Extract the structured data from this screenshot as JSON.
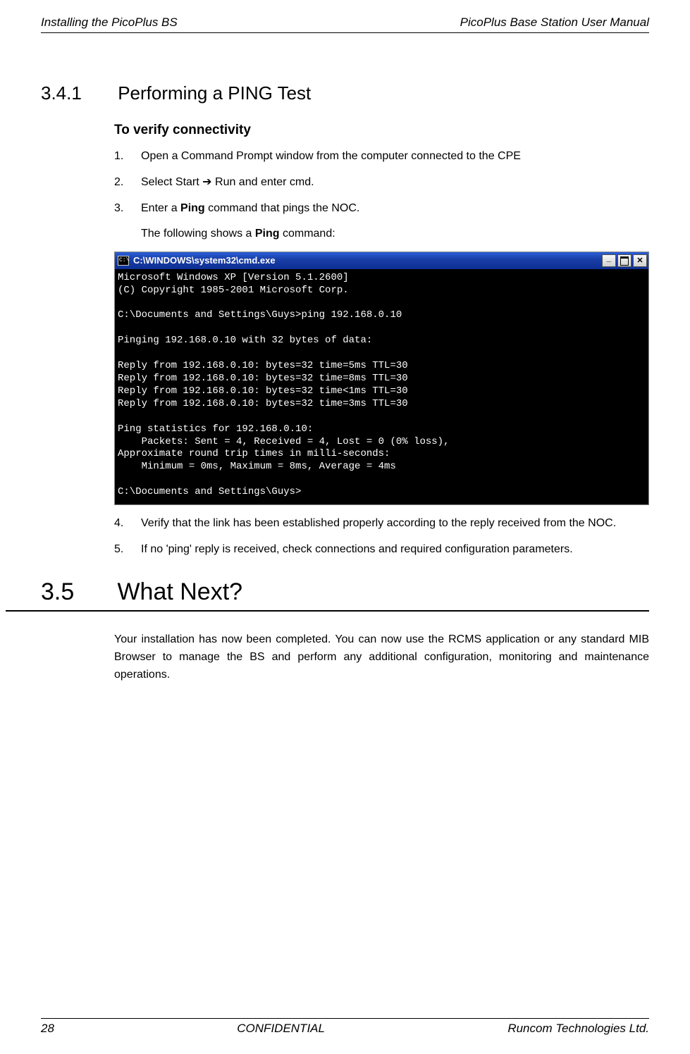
{
  "header": {
    "left": "Installing the PicoPlus BS",
    "right": "PicoPlus Base Station User Manual"
  },
  "section_341": {
    "number": "3.4.1",
    "title": "Performing a PING Test",
    "subhead": "To verify connectivity",
    "steps": [
      {
        "parts": [
          "Open a Command Prompt window from the computer connected to the CPE"
        ]
      },
      {
        "parts": [
          "Select Start ",
          {
            "arrow": "➔"
          },
          " Run and enter cmd."
        ]
      },
      {
        "parts": [
          "Enter a ",
          {
            "b": "Ping"
          },
          " command that pings the NOC."
        ],
        "followup_parts": [
          "The following shows a ",
          {
            "b": "Ping"
          },
          " command:"
        ]
      },
      {
        "parts": [
          "Verify that the link has been established properly according to the reply received from the NOC."
        ]
      },
      {
        "parts": [
          "If no 'ping' reply is received, check connections and required configuration parameters."
        ]
      }
    ]
  },
  "terminal": {
    "title": "C:\\WINDOWS\\system32\\cmd.exe",
    "lines": [
      "Microsoft Windows XP [Version 5.1.2600]",
      "(C) Copyright 1985-2001 Microsoft Corp.",
      "",
      "C:\\Documents and Settings\\Guys>ping 192.168.0.10",
      "",
      "Pinging 192.168.0.10 with 32 bytes of data:",
      "",
      "Reply from 192.168.0.10: bytes=32 time=5ms TTL=30",
      "Reply from 192.168.0.10: bytes=32 time=8ms TTL=30",
      "Reply from 192.168.0.10: bytes=32 time<1ms TTL=30",
      "Reply from 192.168.0.10: bytes=32 time=3ms TTL=30",
      "",
      "Ping statistics for 192.168.0.10:",
      "    Packets: Sent = 4, Received = 4, Lost = 0 (0% loss),",
      "Approximate round trip times in milli-seconds:",
      "    Minimum = 0ms, Maximum = 8ms, Average = 4ms",
      "",
      "C:\\Documents and Settings\\Guys>"
    ]
  },
  "section_35": {
    "number": "3.5",
    "title": "What Next?",
    "body": "Your installation has now been completed. You can now use the RCMS application or any standard MIB Browser to manage the BS and perform any additional configuration, monitoring and maintenance operations."
  },
  "footer": {
    "page": "28",
    "center": "CONFIDENTIAL",
    "right": "Runcom Technologies Ltd."
  }
}
